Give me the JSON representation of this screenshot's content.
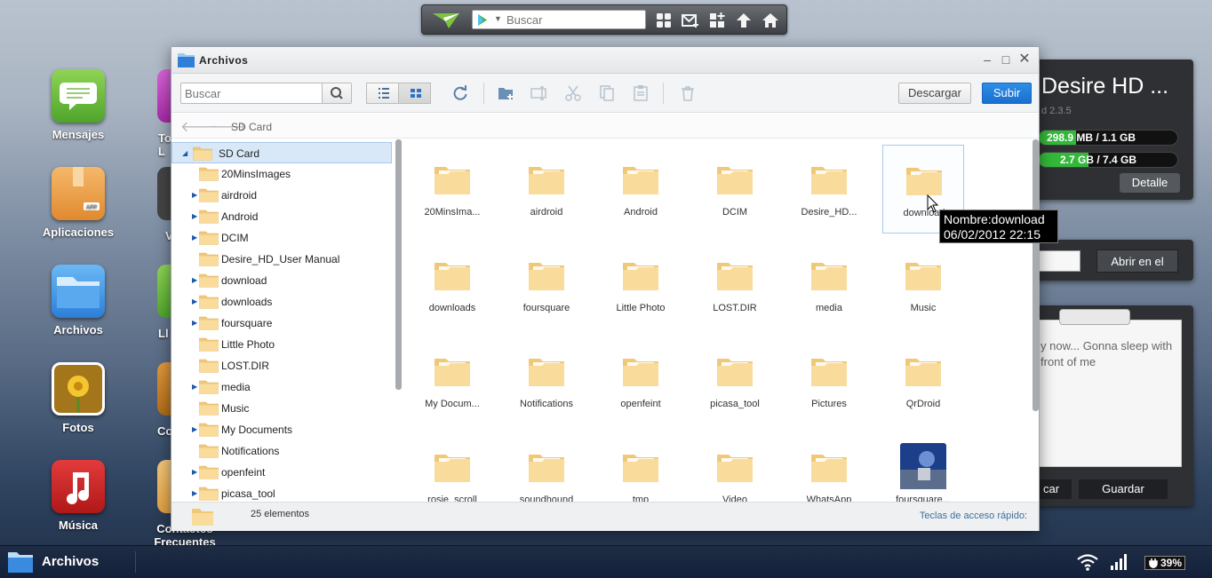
{
  "topbar": {
    "search_placeholder": "Buscar",
    "icons": [
      "airdroid-logo",
      "google-play-icon",
      "apps-grid-icon",
      "mail-icon",
      "add-app-icon",
      "upload-icon",
      "home-icon"
    ]
  },
  "desktop": {
    "col1": [
      {
        "label": "Mensajes",
        "icon": "messages-icon"
      },
      {
        "label": "Aplicaciones",
        "icon": "apps-box-icon"
      },
      {
        "label": "Archivos",
        "icon": "folder-icon"
      },
      {
        "label": "Fotos",
        "icon": "photos-icon"
      },
      {
        "label": "Música",
        "icon": "music-icon"
      }
    ],
    "col2_partial": [
      {
        "label": "To\nL",
        "icon": "partial-icon"
      },
      {
        "label": "V",
        "icon": "partial-icon"
      },
      {
        "label": "Ll",
        "icon": "partial-icon"
      },
      {
        "label": "Co",
        "icon": "partial-icon"
      },
      {
        "label": "Contactos\nFrecuentes",
        "icon": "contacts-icon"
      }
    ]
  },
  "device_widget": {
    "title": "Desire HD ...",
    "version": "d 2.3.5",
    "storage1": "298.9 MB / 1.1 GB",
    "storage1_fill": 0.27,
    "storage2": "2.7 GB / 7.4 GB",
    "storage2_fill": 0.36,
    "detail_button": "Detalle",
    "accent": "#33b93a"
  },
  "url_widget": {
    "open_button": "Abrir en el"
  },
  "note_widget": {
    "text": "y now... Gonna sleep with front of me",
    "cancel_button": "car",
    "save_button": "Guardar"
  },
  "window": {
    "title": "Archivos",
    "search_placeholder": "Buscar",
    "download_button": "Descargar",
    "upload_button": "Subir",
    "breadcrumb": "SD Card",
    "tree": {
      "root": "SD Card",
      "items": [
        {
          "label": "20MinsImages",
          "expandable": false
        },
        {
          "label": "airdroid",
          "expandable": true
        },
        {
          "label": "Android",
          "expandable": true
        },
        {
          "label": "DCIM",
          "expandable": true
        },
        {
          "label": "Desire_HD_User Manual",
          "expandable": false
        },
        {
          "label": "download",
          "expandable": true
        },
        {
          "label": "downloads",
          "expandable": true
        },
        {
          "label": "foursquare",
          "expandable": true
        },
        {
          "label": "Little Photo",
          "expandable": false
        },
        {
          "label": "LOST.DIR",
          "expandable": false
        },
        {
          "label": "media",
          "expandable": true
        },
        {
          "label": "Music",
          "expandable": false
        },
        {
          "label": "My Documents",
          "expandable": true
        },
        {
          "label": "Notifications",
          "expandable": false
        },
        {
          "label": "openfeint",
          "expandable": true
        },
        {
          "label": "picasa_tool",
          "expandable": true
        }
      ]
    },
    "grid": [
      {
        "name": "20MinsIma...",
        "type": "folder"
      },
      {
        "name": "airdroid",
        "type": "folder"
      },
      {
        "name": "Android",
        "type": "folder"
      },
      {
        "name": "DCIM",
        "type": "folder"
      },
      {
        "name": "Desire_HD...",
        "type": "folder"
      },
      {
        "name": "download",
        "type": "folder",
        "selected": true
      },
      {
        "name": "downloads",
        "type": "folder"
      },
      {
        "name": "foursquare",
        "type": "folder"
      },
      {
        "name": "Little Photo",
        "type": "folder"
      },
      {
        "name": "LOST.DIR",
        "type": "folder"
      },
      {
        "name": "media",
        "type": "folder"
      },
      {
        "name": "Music",
        "type": "folder"
      },
      {
        "name": "My Docum...",
        "type": "folder"
      },
      {
        "name": "Notifications",
        "type": "folder"
      },
      {
        "name": "openfeint",
        "type": "folder"
      },
      {
        "name": "picasa_tool",
        "type": "folder"
      },
      {
        "name": "Pictures",
        "type": "folder"
      },
      {
        "name": "QrDroid",
        "type": "folder"
      },
      {
        "name": "rosie_scroll",
        "type": "folder"
      },
      {
        "name": "soundhound",
        "type": "folder"
      },
      {
        "name": "tmp",
        "type": "folder"
      },
      {
        "name": "Video",
        "type": "folder"
      },
      {
        "name": "WhatsApp",
        "type": "folder"
      },
      {
        "name": "foursquare...",
        "type": "image"
      }
    ],
    "status_count": "25 elementos",
    "status_keys": "Teclas de acceso rápido:"
  },
  "tooltip": {
    "line1": "Nombre:download",
    "line2": "06/02/2012 22:15"
  },
  "taskbar": {
    "app": "Archivos",
    "battery": "39%"
  },
  "colors": {
    "folder": "#f7d58f",
    "selection": "#d8e8f8",
    "primary_button": "#1a6fcf"
  }
}
